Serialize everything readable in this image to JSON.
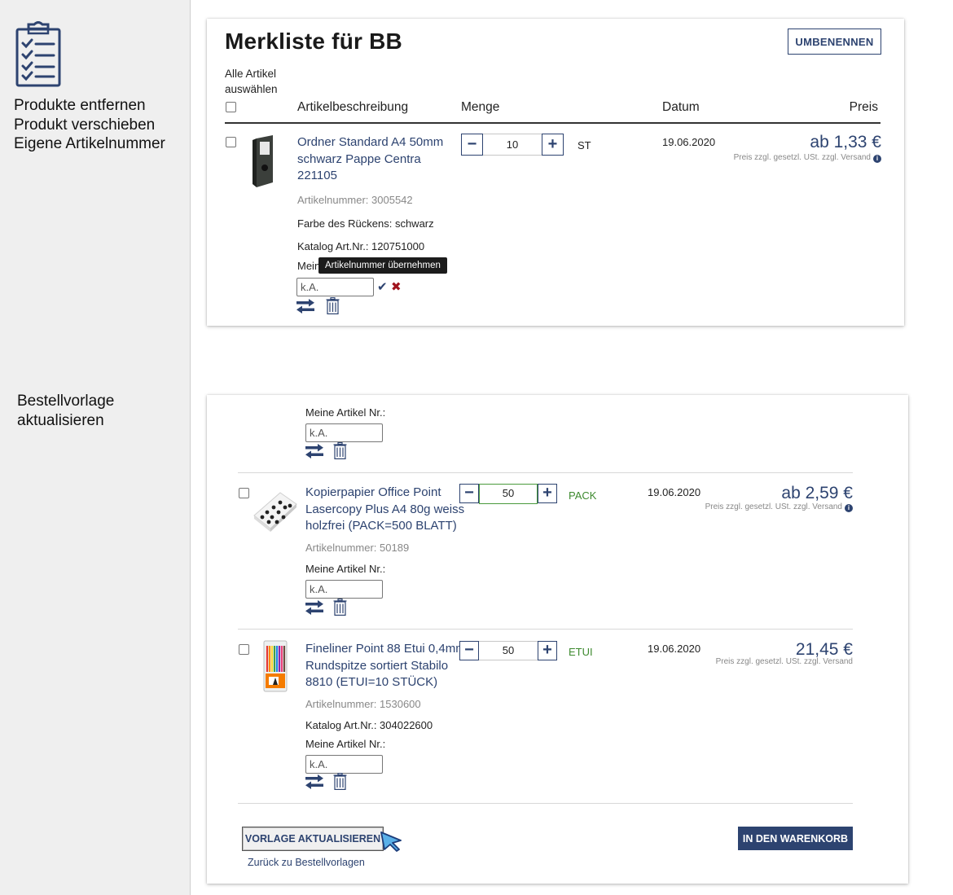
{
  "sidebar": {
    "icon": "clipboard-checklist-icon",
    "links": [
      "Produkte entfernen",
      "Produkt verschieben",
      "Eigene Artikelnummer"
    ],
    "note": [
      "Bestellvorlage",
      "aktualisieren"
    ]
  },
  "card1": {
    "title": "Merkliste für BB",
    "rename_button": "UMBENENNEN",
    "select_all": [
      "Alle Artikel",
      "auswählen"
    ],
    "headers": {
      "description": "Artikelbeschreibung",
      "quantity": "Menge",
      "date": "Datum",
      "price": "Preis"
    },
    "item": {
      "name_lines": [
        "Ordner Standard A4 50mm",
        "schwarz Pappe Centra",
        "221105"
      ],
      "article_no": "Artikelnummer: 3005542",
      "color": "Farbe des Rückens: schwarz",
      "catalog_no": "Katalog Art.Nr.: 120751000",
      "my_no_label_visible": "Mein",
      "tooltip": "Artikelnummer übernehmen",
      "sku_value": "k.A.",
      "quantity": "10",
      "unit": "ST",
      "date": "19.06.2020",
      "price": "ab 1,33 €",
      "price_note": "Preis zzgl. gesetzl. USt. zzgl. Versand"
    }
  },
  "card2": {
    "top_item": {
      "my_no_label": "Meine Artikel Nr.:",
      "sku_value": "k.A."
    },
    "items": [
      {
        "name_lines": [
          "Kopierpapier Office Point",
          "Lasercopy Plus A4 80g weiss",
          "holzfrei (PACK=500 BLATT)"
        ],
        "article_no": "Artikelnummer: 50189",
        "my_no_label": "Meine Artikel Nr.:",
        "sku_value": "k.A.",
        "quantity": "50",
        "unit": "PACK",
        "date": "19.06.2020",
        "price": "ab 2,59 €",
        "price_note": "Preis zzgl. gesetzl. USt. zzgl. Versand"
      },
      {
        "name_lines": [
          "Fineliner Point 88 Etui 0,4mm",
          "Rundspitze sortiert Stabilo",
          "8810 (ETUI=10 STÜCK)"
        ],
        "article_no": "Artikelnummer: 1530600",
        "catalog_no": "Katalog Art.Nr.: 304022600",
        "my_no_label": "Meine Artikel Nr.:",
        "sku_value": "k.A.",
        "quantity": "50",
        "unit": "ETUI",
        "date": "19.06.2020",
        "price": "21,45 €",
        "price_note": "Preis zzgl. gesetzl. USt. zzgl. Versand"
      }
    ],
    "update_button": "VORLAGE AKTUALISIEREN",
    "cart_button": "IN DEN WARENKORB",
    "back_link": "Zurück zu Bestellvorlagen"
  },
  "colors": {
    "brand": "#2d4370",
    "green": "#3e8a2f",
    "error": "#a0141e"
  }
}
